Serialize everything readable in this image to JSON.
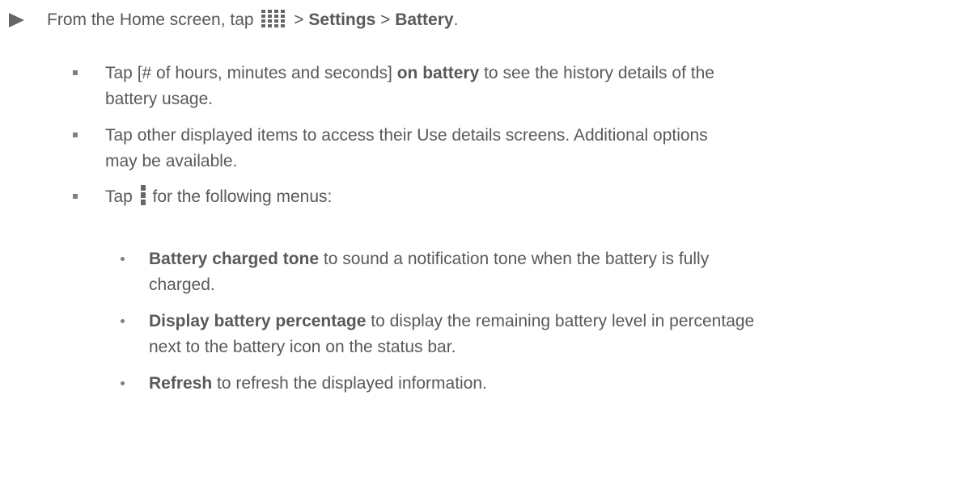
{
  "step": {
    "prefix": "From the Home screen, tap",
    "icon": "apps-grid-icon",
    "sep1": ">",
    "settings": "Settings",
    "sep2": ">",
    "battery": "Battery",
    "end": "."
  },
  "bullets": {
    "b1": {
      "l1_pre": "Tap [# of hours, minutes and seconds]",
      "l1_bold": "on battery",
      "l1_post": "to see the history details of the",
      "l2": "battery usage."
    },
    "b2": {
      "l1": "Tap other displayed items to access their Use details screens. Additional options",
      "l2": "may be available."
    },
    "b3": {
      "pre": "Tap",
      "icon": "menu-overflow-icon",
      "post": "for the following menus:"
    }
  },
  "subitems": {
    "s1": {
      "bold": "Battery charged tone",
      "rest": "to sound a notification tone when the battery is fully",
      "l2": "charged."
    },
    "s2": {
      "bold": "Display battery percentage",
      "rest": "to display the remaining battery level in percentage",
      "l2": "next to the battery icon on the status bar."
    },
    "s3": {
      "bold": "Refresh",
      "rest": "to refresh the displayed information."
    }
  }
}
